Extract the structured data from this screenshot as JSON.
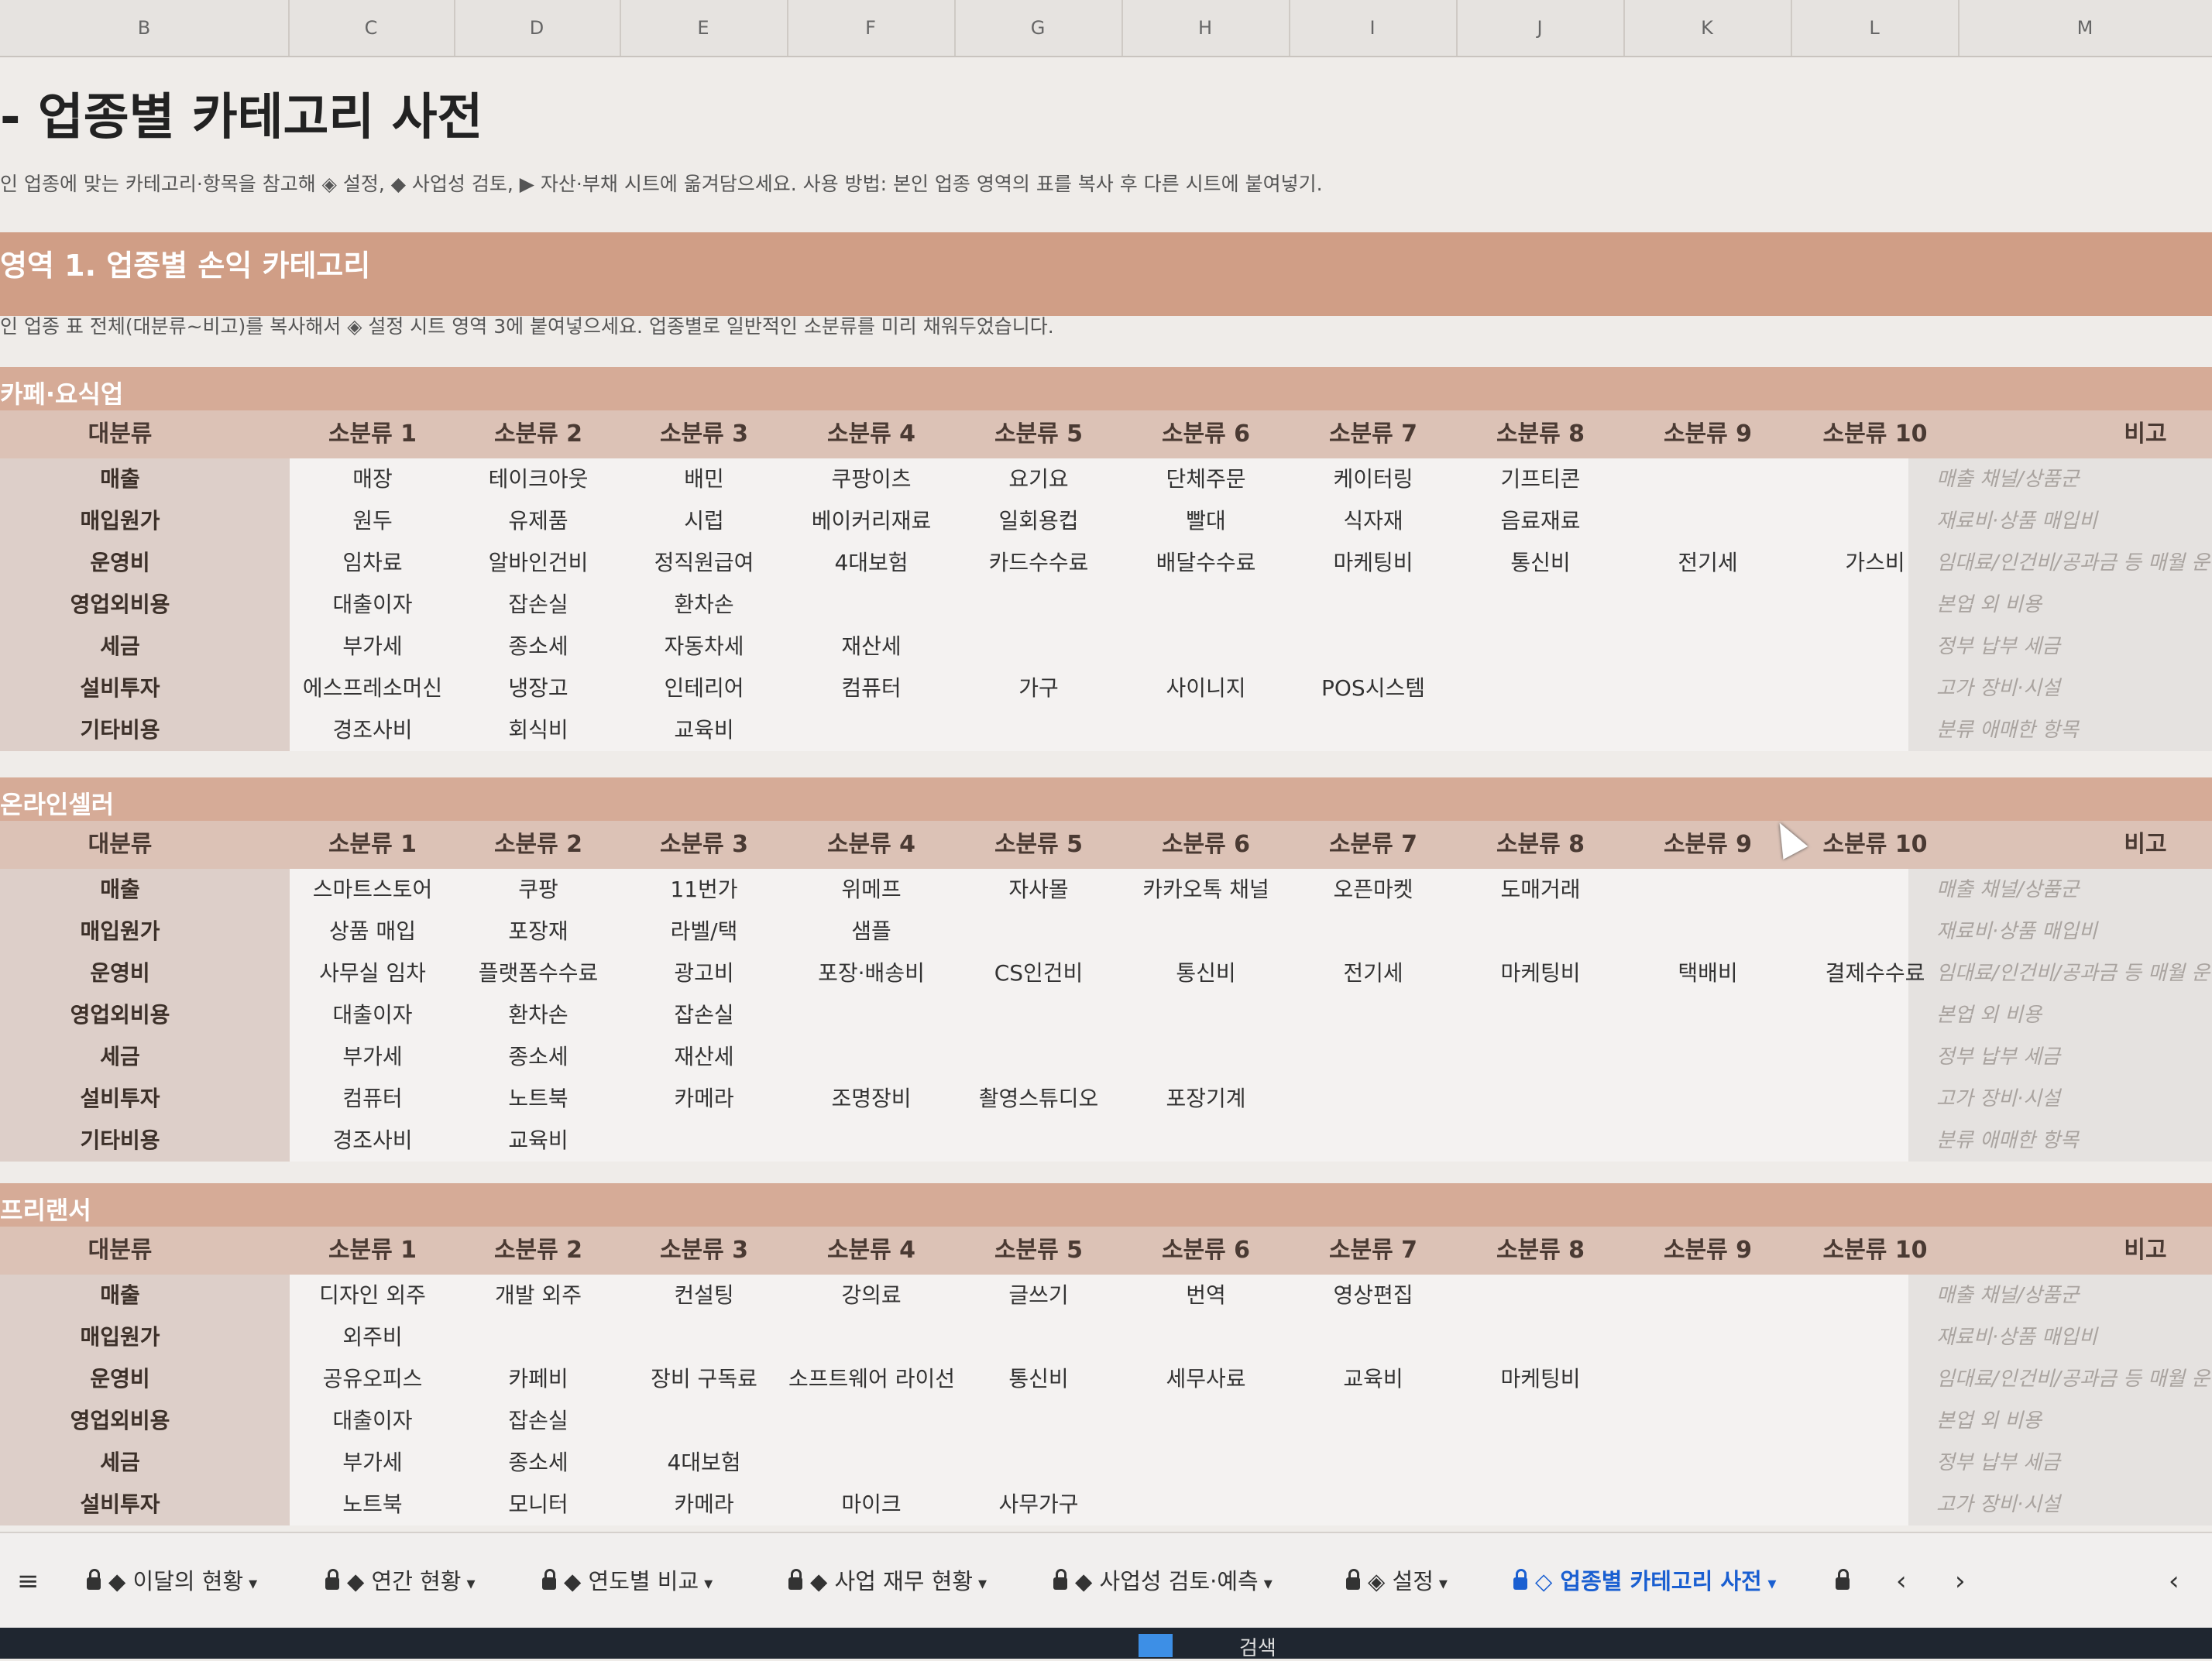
{
  "columns": [
    "B",
    "C",
    "D",
    "E",
    "F",
    "G",
    "H",
    "I",
    "J",
    "K",
    "L",
    "M"
  ],
  "page_title": "- 업종별 카테고리 사전",
  "intro": "인 업종에 맞는 카테고리·항목을 참고해 ◈ 설정, ◆ 사업성 검토, ▶ 자산·부채 시트에 옮겨담으세요. 사용 방법: 본인 업종 영역의 표를 복사 후 다른 시트에 붙여넣기.",
  "section1": {
    "title": "영역 1. 업종별 손익 카테고리",
    "desc": "인 업종 표 전체(대분류~비고)를 복사해서 ◈ 설정 시트 영역 3에 붙여넣으세요. 업종별로 일반적인 소분류를 미리 채워두었습니다."
  },
  "headers": {
    "main": "대분류",
    "subs": [
      "소분류 1",
      "소분류 2",
      "소분류 3",
      "소분류 4",
      "소분류 5",
      "소분류 6",
      "소분류 7",
      "소분류 8",
      "소분류 9",
      "소분류 10"
    ],
    "note": "비고"
  },
  "notes": [
    "매출 채널/상품군",
    "재료비·상품 매입비",
    "임대료/인건비/공과금 등 매월 운영",
    "본업 외 비용",
    "정부 납부 세금",
    "고가 장비·시설",
    "분류 애매한 항목"
  ],
  "industries": [
    {
      "name": "카페·요식업",
      "rows": [
        {
          "cat": "매출",
          "subs": [
            "매장",
            "테이크아웃",
            "배민",
            "쿠팡이츠",
            "요기요",
            "단체주문",
            "케이터링",
            "기프티콘",
            "",
            ""
          ]
        },
        {
          "cat": "매입원가",
          "subs": [
            "원두",
            "유제품",
            "시럽",
            "베이커리재료",
            "일회용컵",
            "빨대",
            "식자재",
            "음료재료",
            "",
            ""
          ]
        },
        {
          "cat": "운영비",
          "subs": [
            "임차료",
            "알바인건비",
            "정직원급여",
            "4대보험",
            "카드수수료",
            "배달수수료",
            "마케팅비",
            "통신비",
            "전기세",
            "가스비"
          ]
        },
        {
          "cat": "영업외비용",
          "subs": [
            "대출이자",
            "잡손실",
            "환차손",
            "",
            "",
            "",
            "",
            "",
            "",
            ""
          ]
        },
        {
          "cat": "세금",
          "subs": [
            "부가세",
            "종소세",
            "자동차세",
            "재산세",
            "",
            "",
            "",
            "",
            "",
            ""
          ]
        },
        {
          "cat": "설비투자",
          "subs": [
            "에스프레소머신",
            "냉장고",
            "인테리어",
            "컴퓨터",
            "가구",
            "사이니지",
            "POS시스템",
            "",
            "",
            ""
          ]
        },
        {
          "cat": "기타비용",
          "subs": [
            "경조사비",
            "회식비",
            "교육비",
            "",
            "",
            "",
            "",
            "",
            "",
            ""
          ]
        }
      ]
    },
    {
      "name": "온라인셀러",
      "rows": [
        {
          "cat": "매출",
          "subs": [
            "스마트스토어",
            "쿠팡",
            "11번가",
            "위메프",
            "자사몰",
            "카카오톡 채널",
            "오픈마켓",
            "도매거래",
            "",
            ""
          ]
        },
        {
          "cat": "매입원가",
          "subs": [
            "상품 매입",
            "포장재",
            "라벨/택",
            "샘플",
            "",
            "",
            "",
            "",
            "",
            ""
          ]
        },
        {
          "cat": "운영비",
          "subs": [
            "사무실 임차",
            "플랫폼수수료",
            "광고비",
            "포장·배송비",
            "CS인건비",
            "통신비",
            "전기세",
            "마케팅비",
            "택배비",
            "결제수수료"
          ]
        },
        {
          "cat": "영업외비용",
          "subs": [
            "대출이자",
            "환차손",
            "잡손실",
            "",
            "",
            "",
            "",
            "",
            "",
            ""
          ]
        },
        {
          "cat": "세금",
          "subs": [
            "부가세",
            "종소세",
            "재산세",
            "",
            "",
            "",
            "",
            "",
            "",
            ""
          ]
        },
        {
          "cat": "설비투자",
          "subs": [
            "컴퓨터",
            "노트북",
            "카메라",
            "조명장비",
            "촬영스튜디오",
            "포장기계",
            "",
            "",
            "",
            ""
          ]
        },
        {
          "cat": "기타비용",
          "subs": [
            "경조사비",
            "교육비",
            "",
            "",
            "",
            "",
            "",
            "",
            "",
            ""
          ]
        }
      ]
    },
    {
      "name": "프리랜서",
      "rows": [
        {
          "cat": "매출",
          "subs": [
            "디자인 외주",
            "개발 외주",
            "컨설팅",
            "강의료",
            "글쓰기",
            "번역",
            "영상편집",
            "",
            "",
            ""
          ]
        },
        {
          "cat": "매입원가",
          "subs": [
            "외주비",
            "",
            "",
            "",
            "",
            "",
            "",
            "",
            "",
            ""
          ]
        },
        {
          "cat": "운영비",
          "subs": [
            "공유오피스",
            "카페비",
            "장비 구독료",
            "소프트웨어 라이선스",
            "통신비",
            "세무사료",
            "교육비",
            "마케팅비",
            "",
            ""
          ]
        },
        {
          "cat": "영업외비용",
          "subs": [
            "대출이자",
            "잡손실",
            "",
            "",
            "",
            "",
            "",
            "",
            "",
            ""
          ]
        },
        {
          "cat": "세금",
          "subs": [
            "부가세",
            "종소세",
            "4대보험",
            "",
            "",
            "",
            "",
            "",
            "",
            ""
          ]
        },
        {
          "cat": "설비투자",
          "subs": [
            "노트북",
            "모니터",
            "카메라",
            "마이크",
            "사무가구",
            "",
            "",
            "",
            "",
            ""
          ]
        }
      ]
    }
  ],
  "tabs": [
    {
      "label": "◆ 이달의 현황",
      "active": false
    },
    {
      "label": "◆ 연간 현황",
      "active": false
    },
    {
      "label": "◆ 연도별 비교",
      "active": false
    },
    {
      "label": "◆ 사업 재무 현황",
      "active": false
    },
    {
      "label": "◆ 사업성 검토·예측",
      "active": false
    },
    {
      "label": "◈ 설정",
      "active": false
    },
    {
      "label": "◇ 업종별 카테고리 사전",
      "active": true
    }
  ],
  "taskbar": {
    "search_label": "검색"
  }
}
